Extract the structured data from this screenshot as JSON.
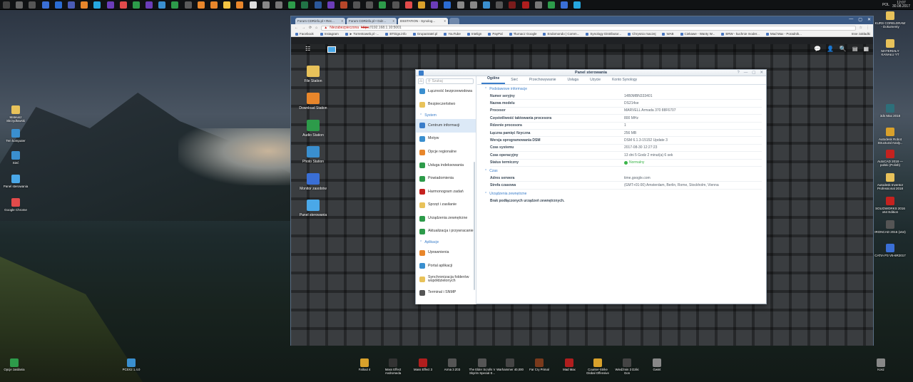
{
  "taskbar": {
    "icon_colors": [
      "#444",
      "#666",
      "#555",
      "#3a6fd6",
      "#2b6cd3",
      "#4a5bb5",
      "#e8862b",
      "#26a8e0",
      "#6b3db8",
      "#e24b4b",
      "#2d9b4a",
      "#6b3db8",
      "#3a8fcf",
      "#2d9b4a",
      "#5a5a5a",
      "#e8862b",
      "#e8862b",
      "#f5c542",
      "#e8862b",
      "#ddd",
      "#888",
      "#777",
      "#2d9b4a",
      "#217346",
      "#2b579a",
      "#6b3db8",
      "#b7472a",
      "#555",
      "#555",
      "#2d9b4a",
      "#555",
      "#e24b4b",
      "#d9a12b",
      "#6b3db8",
      "#2b6cd3",
      "#888",
      "#888",
      "#3a8fcf",
      "#555",
      "#7a1c1c",
      "#b01e1e",
      "#777",
      "#2d9b4a",
      "#3a6fd6",
      "#26a8e0"
    ],
    "lang": "POL",
    "time": "12:07",
    "date": "30.08.2017"
  },
  "desktop_left": [
    {
      "label": "Mateusz Skrzydłowski",
      "color": "#e8c25a"
    },
    {
      "label": "Ten komputer",
      "color": "#3a8fcf"
    },
    {
      "label": "Sieć",
      "color": "#3a8fcf"
    },
    {
      "label": "Panel sterowania",
      "color": "#4aa8e8"
    },
    {
      "label": "Google Chrome",
      "color": "#e24b4b"
    }
  ],
  "desktop_right": [
    {
      "label": "KURS CORELDRAW - Dokumenty",
      "color": "#e8c25a"
    },
    {
      "label": "MATERIAŁY KANAŁU YT",
      "color": "#e8c25a"
    },
    {
      "label": "3ds Max 2018",
      "color": "#2d6f7a"
    },
    {
      "label": "Autodesk Robot Structural Analy...",
      "color": "#d9a12b"
    },
    {
      "label": "AutoCAD 2018 — polski (Polish)",
      "color": "#c5221f"
    },
    {
      "label": "Autodesk Inventor Professional 2018",
      "color": "#e8c25a"
    },
    {
      "label": "SOLIDWORKS 2016 x64 Edition",
      "color": "#c5221f"
    },
    {
      "label": "IRONCAD 2016 (x64)",
      "color": "#555"
    },
    {
      "label": "CATIA P3 V5-6R2017",
      "color": "#3a6fd6"
    }
  ],
  "bottom_icons": [
    {
      "label": "Opcje zasilania",
      "color": "#2d9b4a"
    },
    {
      "label": "PCSX2 1.4.0",
      "color": "#3a8fcf"
    },
    {
      "label": "Fallout 4",
      "color": "#d9a12b"
    },
    {
      "label": "Mass Effect Andromeda",
      "color": "#333"
    },
    {
      "label": "Mass Effect 3",
      "color": "#b01e1e"
    },
    {
      "label": "Arma 3 Z03",
      "color": "#555"
    },
    {
      "label": "The Elder Scrolls V Skyrim Special E...",
      "color": "#555"
    },
    {
      "label": "Warhammer 40,000",
      "color": "#444"
    },
    {
      "label": "Far Cry Primal",
      "color": "#7a3a1c"
    },
    {
      "label": "Mad Max",
      "color": "#b01e1e"
    },
    {
      "label": "Counter-Strike Global Offensive",
      "color": "#d9a12b"
    },
    {
      "label": "Wiedźmin 3 Dziki Gon",
      "color": "#444"
    },
    {
      "label": "Gwint",
      "color": "#888"
    },
    {
      "label": "Kosz",
      "color": "#888"
    }
  ],
  "browser": {
    "tabs": [
      {
        "title": "Forum CDRinfo.pl • Rec..."
      },
      {
        "title": "Forum CDRinfo.pl • Gdz..."
      },
      {
        "title": "DSSTATION - Synolog..."
      }
    ],
    "insecure_label": "Niezabezpieczona",
    "url_scheme": "https",
    "url": "://192.168.1.10:5001",
    "other_bookmarks": "Inne zakładki",
    "bookmarks": [
      "Facebook",
      "Instagram",
      "► Torrentoweb.pl -...",
      "BTDigs.info",
      "Grupa4ratel.pl",
      "YouTube",
      "Intelign",
      "PayPal",
      "Tłumacz Google",
      "Endomondo | Comm...",
      "Synology Distributor...",
      "Chrysnio maczej",
      "WAB",
      "Ciekawe - Wanty W...",
      "BRW - kuchnie moder...",
      "Mad Max - Poradnik..."
    ]
  },
  "dsm": {
    "apps_glyph": "☷",
    "right_icons": [
      "💬",
      "👤",
      "🔍",
      "▤",
      "▦"
    ],
    "icons": [
      {
        "label": "File Station",
        "color": "#e8c25a"
      },
      {
        "label": "Download Station",
        "color": "#e8862b"
      },
      {
        "label": "Audio Station",
        "color": "#2d9b4a"
      },
      {
        "label": "Photo Station",
        "color": "#3a8fcf"
      },
      {
        "label": "Monitor zasobów",
        "color": "#3a6fd6"
      },
      {
        "label": "Panel sterowania",
        "color": "#4aa8e8"
      }
    ]
  },
  "control_panel": {
    "title": "Panel sterowania",
    "window_controls": [
      "?",
      "—",
      "▢",
      "✕"
    ],
    "search_placeholder": "Szukaj",
    "sidebar": [
      {
        "type": "item",
        "label": "Łączność bezprzewodowa",
        "color": "#3a8fcf"
      },
      {
        "type": "item",
        "label": "Bezpieczeństwo",
        "color": "#e8c25a"
      },
      {
        "type": "group",
        "label": "System"
      },
      {
        "type": "item",
        "label": "Centrum informacji",
        "color": "#3a7dc9",
        "active": true
      },
      {
        "type": "item",
        "label": "Motyw",
        "color": "#3a8fcf"
      },
      {
        "type": "item",
        "label": "Opcje regionalne",
        "color": "#e8862b"
      },
      {
        "type": "item",
        "label": "Usługa indeksowania",
        "color": "#2d9b4a"
      },
      {
        "type": "item",
        "label": "Powiadomienia",
        "color": "#2d9b4a"
      },
      {
        "type": "item",
        "label": "Harmonogram zadań",
        "color": "#c5221f"
      },
      {
        "type": "item",
        "label": "Sprzęt i zasilanie",
        "color": "#e8c25a"
      },
      {
        "type": "item",
        "label": "Urządzenia zewnętrzne",
        "color": "#2d9b4a"
      },
      {
        "type": "item",
        "label": "Aktualizacja i przywracanie",
        "color": "#2d9b4a"
      },
      {
        "type": "group",
        "label": "Aplikacje"
      },
      {
        "type": "item",
        "label": "Uprawnienia",
        "color": "#e8862b"
      },
      {
        "type": "item",
        "label": "Portal aplikacji",
        "color": "#3a8fcf"
      },
      {
        "type": "item",
        "label": "Synchronizacja folderów współdzielonych",
        "color": "#e8c25a"
      },
      {
        "type": "item",
        "label": "Terminal i SNMP",
        "color": "#555"
      }
    ],
    "tabs": [
      "Ogólne",
      "Sieć",
      "Przechowywanie",
      "Usługa",
      "Użycie",
      "Konto Synology"
    ],
    "active_tab": 0,
    "sections": [
      {
        "title": "Podstawowe informacje",
        "rows": [
          {
            "key": "Numer seryjny",
            "value": "14B0MBN333401"
          },
          {
            "key": "Nazwa modelu",
            "value": "DS214se"
          },
          {
            "key": "Procesor",
            "value": "MARVELL Armada 370 88F6707"
          },
          {
            "key": "Częstotliwość taktowania procesora",
            "value": "800 MHz"
          },
          {
            "key": "Rdzenie procesora",
            "value": "1"
          },
          {
            "key": "Łączna pamięć fizyczna",
            "value": "256 MB"
          },
          {
            "key": "Wersja oprogramowania DSM",
            "value": "DSM 6.1.3-15152 Update 3"
          },
          {
            "key": "Czas systemu",
            "value": "2017-08-30 12:27:23"
          },
          {
            "key": "Czas operacyjny",
            "value": "13 dni 5 Godz 2 minut(a) 6 sek"
          },
          {
            "key": "Status termiczny",
            "value": "Normalny",
            "status": "ok"
          }
        ]
      },
      {
        "title": "Czas",
        "rows": [
          {
            "key": "Adres serwera",
            "value": "time.google.com"
          },
          {
            "key": "Strefa czasowa",
            "value": "(GMT+01:00) Amsterdam, Berlin, Rome, Stockholm, Vienna"
          }
        ]
      },
      {
        "title": "Urządzenia zewnętrzne",
        "rows": [],
        "empty": "Brak podłączonych urządzeń zewnętrznych."
      }
    ]
  }
}
